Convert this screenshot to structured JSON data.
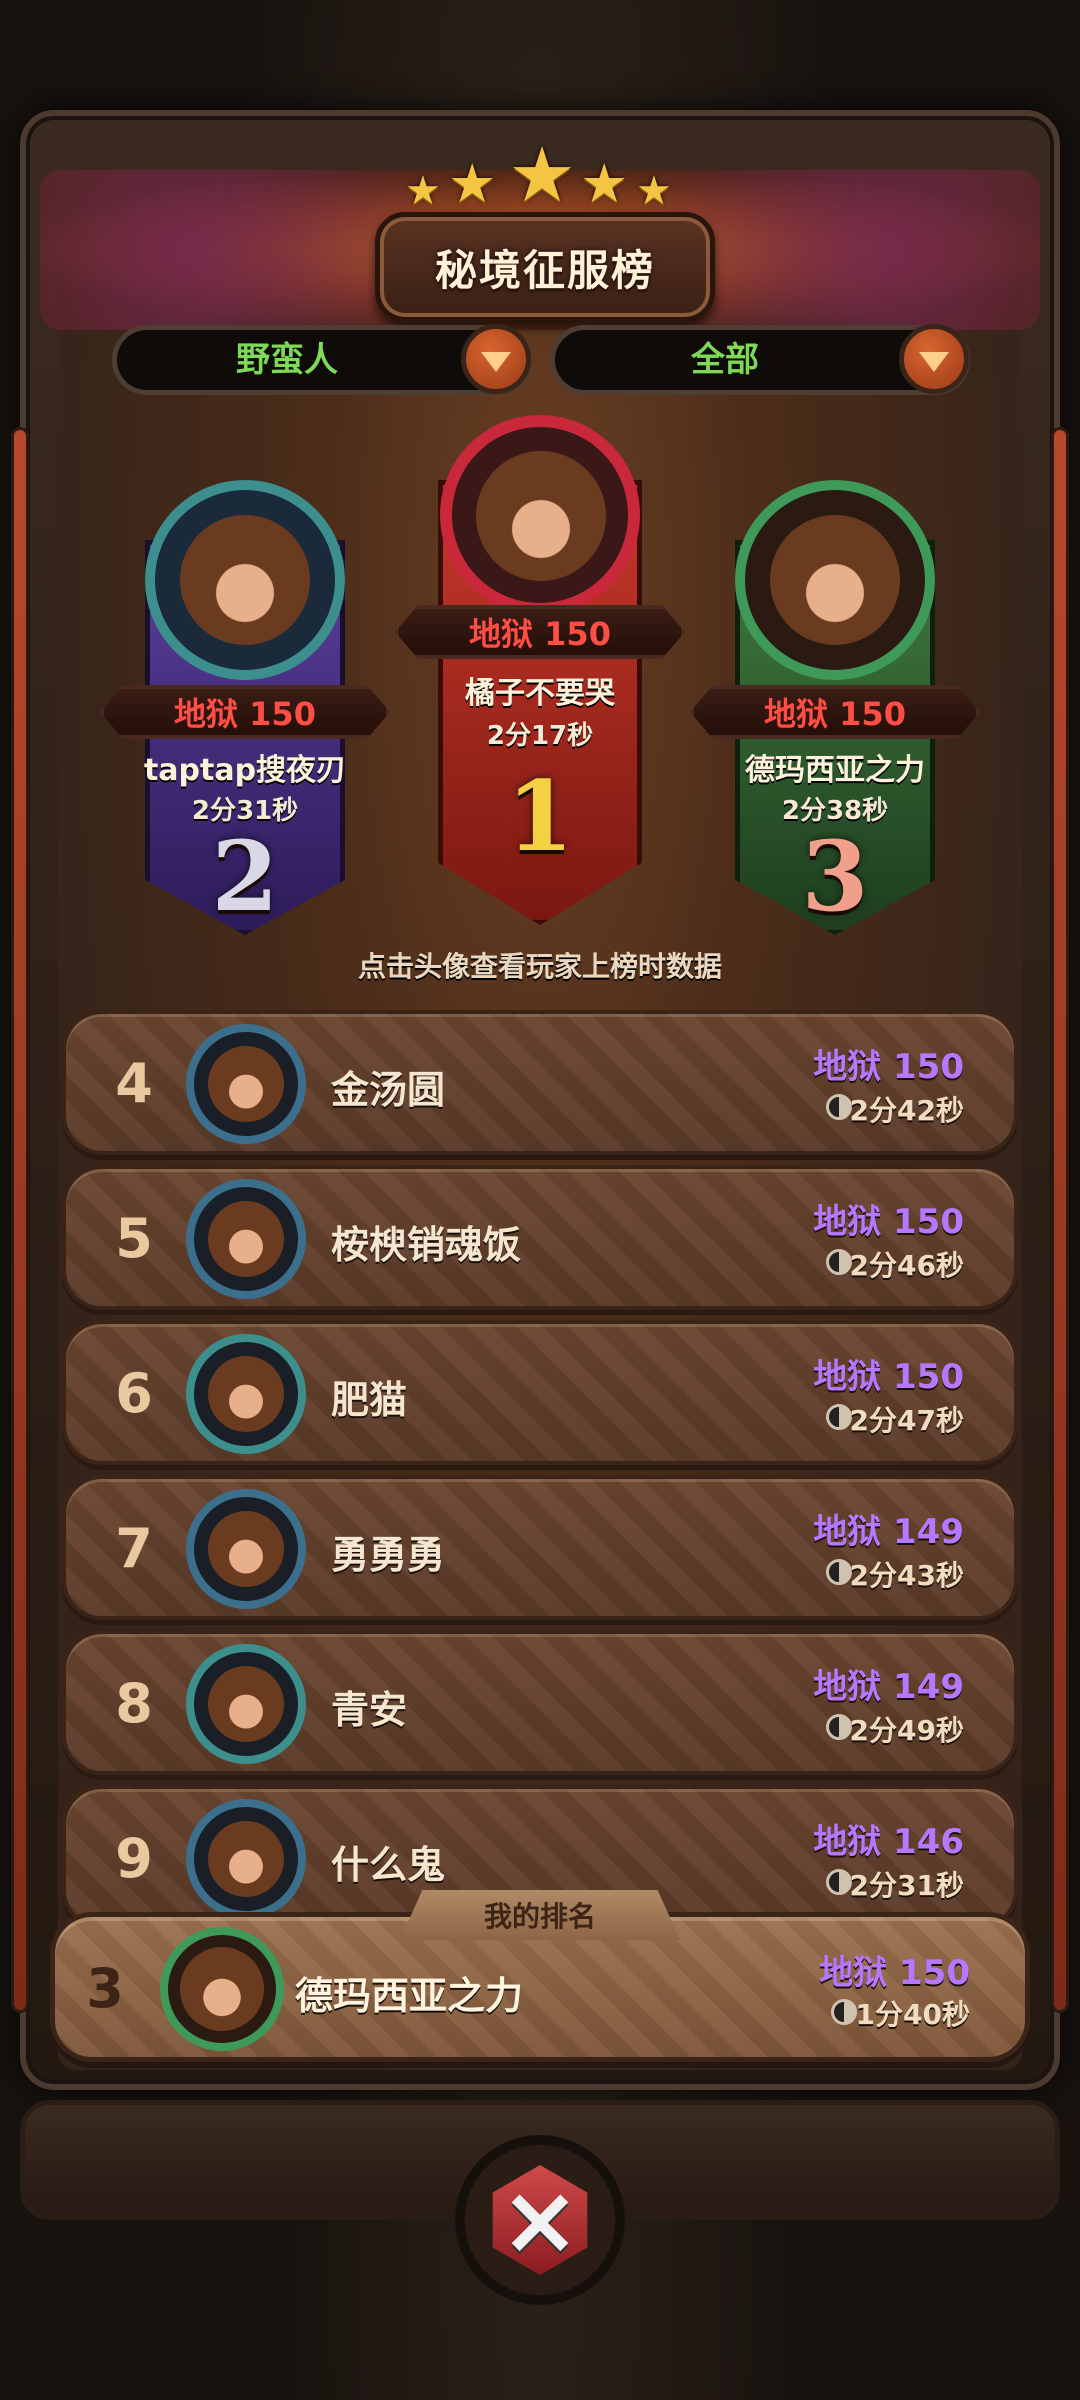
{
  "header": {
    "title": "秘境征服榜",
    "star_count": 5
  },
  "filters": {
    "class_select": {
      "value": "野蛮人"
    },
    "scope_select": {
      "value": "全部"
    }
  },
  "podium": [
    {
      "rank": "1",
      "level": "地狱 150",
      "name": "橘子不要哭",
      "time": "2分17秒"
    },
    {
      "rank": "2",
      "level": "地狱 150",
      "name": "taptap搜夜刃",
      "time": "2分31秒"
    },
    {
      "rank": "3",
      "level": "地狱 150",
      "name": "德玛西亚之力",
      "time": "2分38秒"
    }
  ],
  "hint": "点击头像查看玩家上榜时数据",
  "rows": [
    {
      "rank": "4",
      "name": "金汤圆",
      "level": "地狱 150",
      "time": "2分42秒",
      "avatar": "bull-avatar"
    },
    {
      "rank": "5",
      "name": "桉楰销魂饭",
      "level": "地狱 150",
      "time": "2分46秒",
      "avatar": "knight-avatar"
    },
    {
      "rank": "6",
      "name": "肥猫",
      "level": "地狱 150",
      "time": "2分47秒",
      "avatar": "bear-avatar"
    },
    {
      "rank": "7",
      "name": "勇勇勇",
      "level": "地狱 149",
      "time": "2分43秒",
      "avatar": "bull-avatar"
    },
    {
      "rank": "8",
      "name": "青安",
      "level": "地狱 149",
      "time": "2分49秒",
      "avatar": "bear-avatar"
    },
    {
      "rank": "9",
      "name": "什么鬼",
      "level": "地狱 146",
      "time": "2分31秒",
      "avatar": "bull-avatar"
    }
  ],
  "my_rank": {
    "tag": "我的排名",
    "rank": "3",
    "name": "德玛西亚之力",
    "level": "地狱 150",
    "time": "1分40秒"
  },
  "colors": {
    "level_red": "#ff4f45",
    "level_purple": "#b678ff",
    "filter_green": "#7ed957",
    "gold": "#f4c542"
  }
}
